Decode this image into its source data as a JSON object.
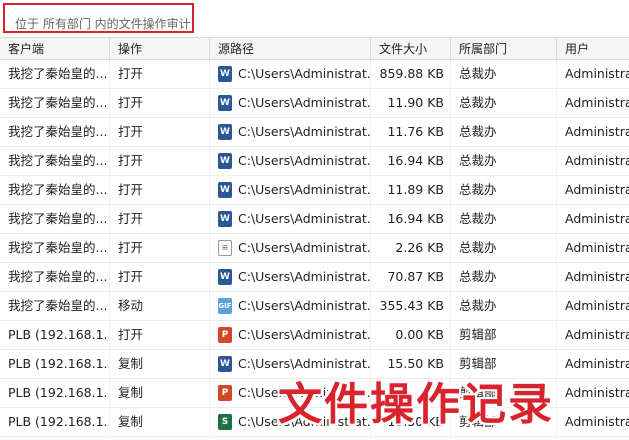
{
  "location": {
    "text": "位于 所有部门 内的文件操作审计"
  },
  "columns": [
    "客户端",
    "操作",
    "源路径",
    "文件大小",
    "所属部门",
    "用户"
  ],
  "rows": [
    {
      "client": "我挖了秦始皇的...",
      "action": "打开",
      "icon": "word-file-icon",
      "path": "C:\\Users\\Administrat...",
      "size": "859.88 KB",
      "dept": "总裁办",
      "user": "Administra..."
    },
    {
      "client": "我挖了秦始皇的...",
      "action": "打开",
      "icon": "word-file-icon",
      "path": "C:\\Users\\Administrat...",
      "size": "11.90 KB",
      "dept": "总裁办",
      "user": "Administra..."
    },
    {
      "client": "我挖了秦始皇的...",
      "action": "打开",
      "icon": "word-file-icon",
      "path": "C:\\Users\\Administrat...",
      "size": "11.76 KB",
      "dept": "总裁办",
      "user": "Administra..."
    },
    {
      "client": "我挖了秦始皇的...",
      "action": "打开",
      "icon": "word-file-icon",
      "path": "C:\\Users\\Administrat...",
      "size": "16.94 KB",
      "dept": "总裁办",
      "user": "Administra..."
    },
    {
      "client": "我挖了秦始皇的...",
      "action": "打开",
      "icon": "word-file-icon",
      "path": "C:\\Users\\Administrat...",
      "size": "11.89 KB",
      "dept": "总裁办",
      "user": "Administra..."
    },
    {
      "client": "我挖了秦始皇的...",
      "action": "打开",
      "icon": "word-file-icon",
      "path": "C:\\Users\\Administrat...",
      "size": "16.94 KB",
      "dept": "总裁办",
      "user": "Administra..."
    },
    {
      "client": "我挖了秦始皇的...",
      "action": "打开",
      "icon": "text-file-icon",
      "path": "C:\\Users\\Administrat...",
      "size": "2.26 KB",
      "dept": "总裁办",
      "user": "Administra..."
    },
    {
      "client": "我挖了秦始皇的...",
      "action": "打开",
      "icon": "word-file-icon",
      "path": "C:\\Users\\Administrat...",
      "size": "70.87 KB",
      "dept": "总裁办",
      "user": "Administra..."
    },
    {
      "client": "我挖了秦始皇的...",
      "action": "移动",
      "icon": "gif-file-icon",
      "path": "C:\\Users\\Administrat...",
      "size": "355.43 KB",
      "dept": "总裁办",
      "user": "Administra..."
    },
    {
      "client": "PLB (192.168.1...",
      "action": "打开",
      "icon": "ppt-file-icon",
      "path": "C:\\Users\\Administrat...",
      "size": "0.00 KB",
      "dept": "剪辑部",
      "user": "Administra..."
    },
    {
      "client": "PLB (192.168.1...",
      "action": "复制",
      "icon": "word-file-icon",
      "path": "C:\\Users\\Administrat...",
      "size": "15.50 KB",
      "dept": "剪辑部",
      "user": "Administra..."
    },
    {
      "client": "PLB (192.168.1...",
      "action": "复制",
      "icon": "ppt-file-icon",
      "path": "C:\\Users\\Administrat...",
      "size": "",
      "dept": "剪辑部",
      "user": "Administra..."
    },
    {
      "client": "PLB (192.168.1...",
      "action": "复制",
      "icon": "excel-file-icon",
      "path": "C:\\Users\\Administrat...",
      "size": "13.50 KB",
      "dept": "剪辑部",
      "user": "Administra..."
    }
  ],
  "watermark": "文件操作记录"
}
